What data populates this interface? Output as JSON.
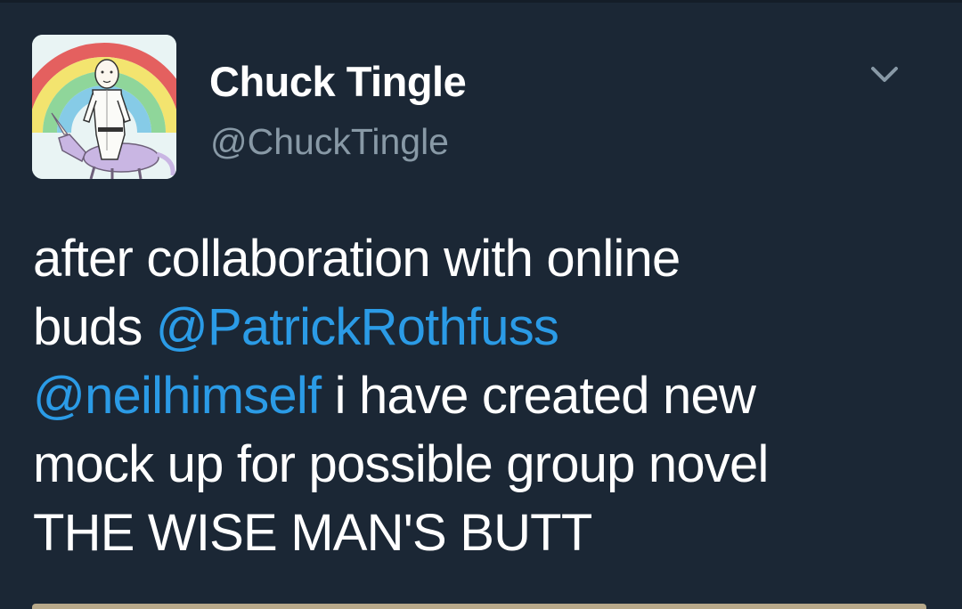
{
  "author": {
    "display_name": "Chuck Tingle",
    "handle": "@ChuckTingle",
    "avatar_icon": "unicorn-rider-avatar"
  },
  "menu": {
    "icon": "chevron-down-icon"
  },
  "tweet": {
    "line1": "after collaboration with online",
    "line2_prefix": "buds ",
    "mention1": "@PatrickRothfuss",
    "mention2": "@neilhimself",
    "line3_suffix": " i have created new",
    "line4": "mock up for possible group novel",
    "line5": "THE WISE MAN'S BUTT"
  },
  "colors": {
    "background": "#1b2735",
    "text": "#ffffff",
    "secondary": "#8899a6",
    "mention": "#2b9be6"
  }
}
